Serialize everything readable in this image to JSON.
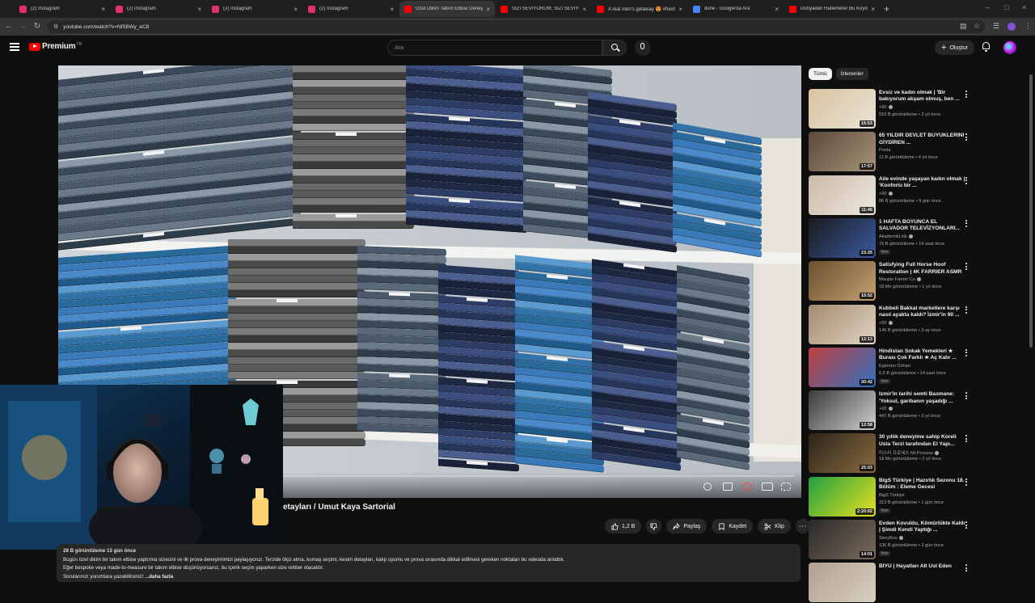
{
  "browser": {
    "tabs": [
      {
        "title": "(2) Instagram",
        "color": "#e1306c",
        "active": false
      },
      {
        "title": "(2) Instagram",
        "color": "#e1306c",
        "active": false
      },
      {
        "title": "(2) Instagram",
        "color": "#e1306c",
        "active": false
      },
      {
        "title": "(2) Instagram",
        "color": "#e1306c",
        "active": false
      },
      {
        "title": "Özel Dikim Takım Elbise Deneyi",
        "color": "#ff0000",
        "active": true
      },
      {
        "title": "SİZİ SEVİYORUM, SİZİ SEVİYOR",
        "color": "#ff0000",
        "active": false
      },
      {
        "title": "A real men's getaway 😍 #food",
        "color": "#ff0000",
        "active": false
      },
      {
        "title": "dune - Google'da Ara",
        "color": "#4285f4",
        "active": false
      },
      {
        "title": "Dünyadan Haberlerle! Bu Köyd",
        "color": "#ff0000",
        "active": false
      }
    ],
    "url": "youtube.com/watch?v=NfS6Wy_eC8"
  },
  "header": {
    "logo_text": "Premium",
    "logo_badge": "TR",
    "search_placeholder": "Ara",
    "create_label": "Oluştur"
  },
  "video": {
    "title": "etayları / Umut Kaya Sartorial",
    "progress": 0.0,
    "like_count": "1,2 B",
    "share_label": "Paylaş",
    "save_label": "Kaydet",
    "clip_label": "Klip"
  },
  "description": {
    "meta": "28 B görüntüleme  13 gün önce",
    "line1": "Bugün özel dikim bir takım elbise yaptırma sürecini ve ilk prova deneyimimizi paylaşıyoruz. Terzide ölçü alma, kumaş seçimi, kesim detayları, kalıp uyumu ve prova sırasında dikkat edilmesi gereken noktaları bu videoda anlattık.",
    "line2": "Eğer bespoke veya made-to-measure bir takım elbise düşünüyorsanız, bu içerik seçim yaparken size rehber olacaktır.",
    "line3": "Sorularınızı yorumlara yazabilirsiniz! ",
    "more": "...daha fazla"
  },
  "sidebar": {
    "chips": [
      "Tümü",
      "İzlenenler"
    ],
    "recommendations": [
      {
        "title": "Evsiz ve kadın olmak | 'Bir bakıyorum akşam olmuş, ben ...",
        "channel": "+90",
        "verified": true,
        "meta": "553 B görüntüleme • 3 yıl önce",
        "duration": "15:53",
        "badge": "",
        "thumb_colors": [
          "#d9c3a0",
          "#e9e3d6"
        ]
      },
      {
        "title": "65 YILDIR DEVLET BÜYÜKLERİNİ GİYDİREN ...",
        "channel": "Posta",
        "verified": false,
        "meta": "11 B görüntüleme • 4 yıl önce",
        "duration": "17:57",
        "badge": "",
        "thumb_colors": [
          "#5a4a3a",
          "#a69278"
        ]
      },
      {
        "title": "Aile evinde yaşayan kadın olmak | 'Konforlu bir ...",
        "channel": "+90",
        "verified": true,
        "meta": "86 B görüntüleme • 9 gün önce",
        "duration": "11:46",
        "badge": "",
        "thumb_colors": [
          "#c9b9a8",
          "#efe8df"
        ]
      },
      {
        "title": "1 HAFTA BOYUNCA EL SALVADOR TELEVİZYONLARI...",
        "channel": "AkademikLink",
        "verified": true,
        "meta": "76 B görüntüleme • 14 saat önce",
        "duration": "23:25",
        "badge": "Yeni",
        "thumb_colors": [
          "#1a1a1a",
          "#3a5aa0"
        ]
      },
      {
        "title": "Satisfying Full Horse Hoof Restoration | 4K FARRIER ASMR",
        "channel": "Maupin Farrier Co",
        "verified": true,
        "meta": "18 Mn görüntüleme • 1 yıl önce",
        "duration": "15:52",
        "badge": "",
        "thumb_colors": [
          "#6b5030",
          "#c2a070"
        ]
      },
      {
        "title": "Kubbeli Bakkal marketlere karşı nasıl ayakta kaldı? İzmir'in 90 ...",
        "channel": "+90",
        "verified": true,
        "meta": "145 B görüntüleme • 3 ay önce",
        "duration": "12:13",
        "badge": "",
        "thumb_colors": [
          "#a58a70",
          "#e0d4c2"
        ]
      },
      {
        "title": "Hindistan Sokak Yemekleri ★ Burası Çok Farklı ★ Aç Kalır ...",
        "channel": "Egemen Özhan",
        "verified": false,
        "meta": "6,5 B görüntüleme • 14 saat önce",
        "duration": "30:42",
        "badge": "Yeni",
        "thumb_colors": [
          "#c04040",
          "#3070c0"
        ]
      },
      {
        "title": "İzmir'in tarihi semti Basmane: 'Yoksul, garibanın yaşadığı ...",
        "channel": "+90",
        "verified": true,
        "meta": "447 B görüntüleme • 2 yıl önce",
        "duration": "12:58",
        "badge": "",
        "thumb_colors": [
          "#3a3a3a",
          "#d0d0d0"
        ]
      },
      {
        "title": "30 yıllık deneyime sahip Koreli Usta Terzi tarafından El Yapı...",
        "channel": "미스터 프로세스 Mr.Process",
        "verified": true,
        "meta": "18 Mn görüntüleme • 2 yıl önce",
        "duration": "25:03",
        "badge": "",
        "thumb_colors": [
          "#2a2418",
          "#8a6a40"
        ]
      },
      {
        "title": "BigS Türkiye | Hazırlık Sezonu 18. Bölüm : Eleme Gecesi",
        "channel": "BigS Türkiye",
        "verified": false,
        "meta": "313 B görüntüleme • 1 gün önce",
        "duration": "2:20:02",
        "badge": "Yeni",
        "thumb_colors": [
          "#20a040",
          "#e8e020"
        ]
      },
      {
        "title": "Evden Kovuldu, Kömürlükte Kaldı | Şimdi Kendi Yaptığı ...",
        "channel": "StoryBox",
        "verified": true,
        "meta": "136 B görüntüleme • 3 gün önce",
        "duration": "14:01",
        "badge": "Yeni",
        "thumb_colors": [
          "#2a2a2a",
          "#7a6a5a"
        ]
      },
      {
        "title": "BİYÜ | Hayatları Alt Üst Eden",
        "channel": "",
        "verified": false,
        "meta": "",
        "duration": "",
        "badge": "",
        "thumb_colors": [
          "#b0a090",
          "#d8d0c0"
        ]
      }
    ]
  }
}
